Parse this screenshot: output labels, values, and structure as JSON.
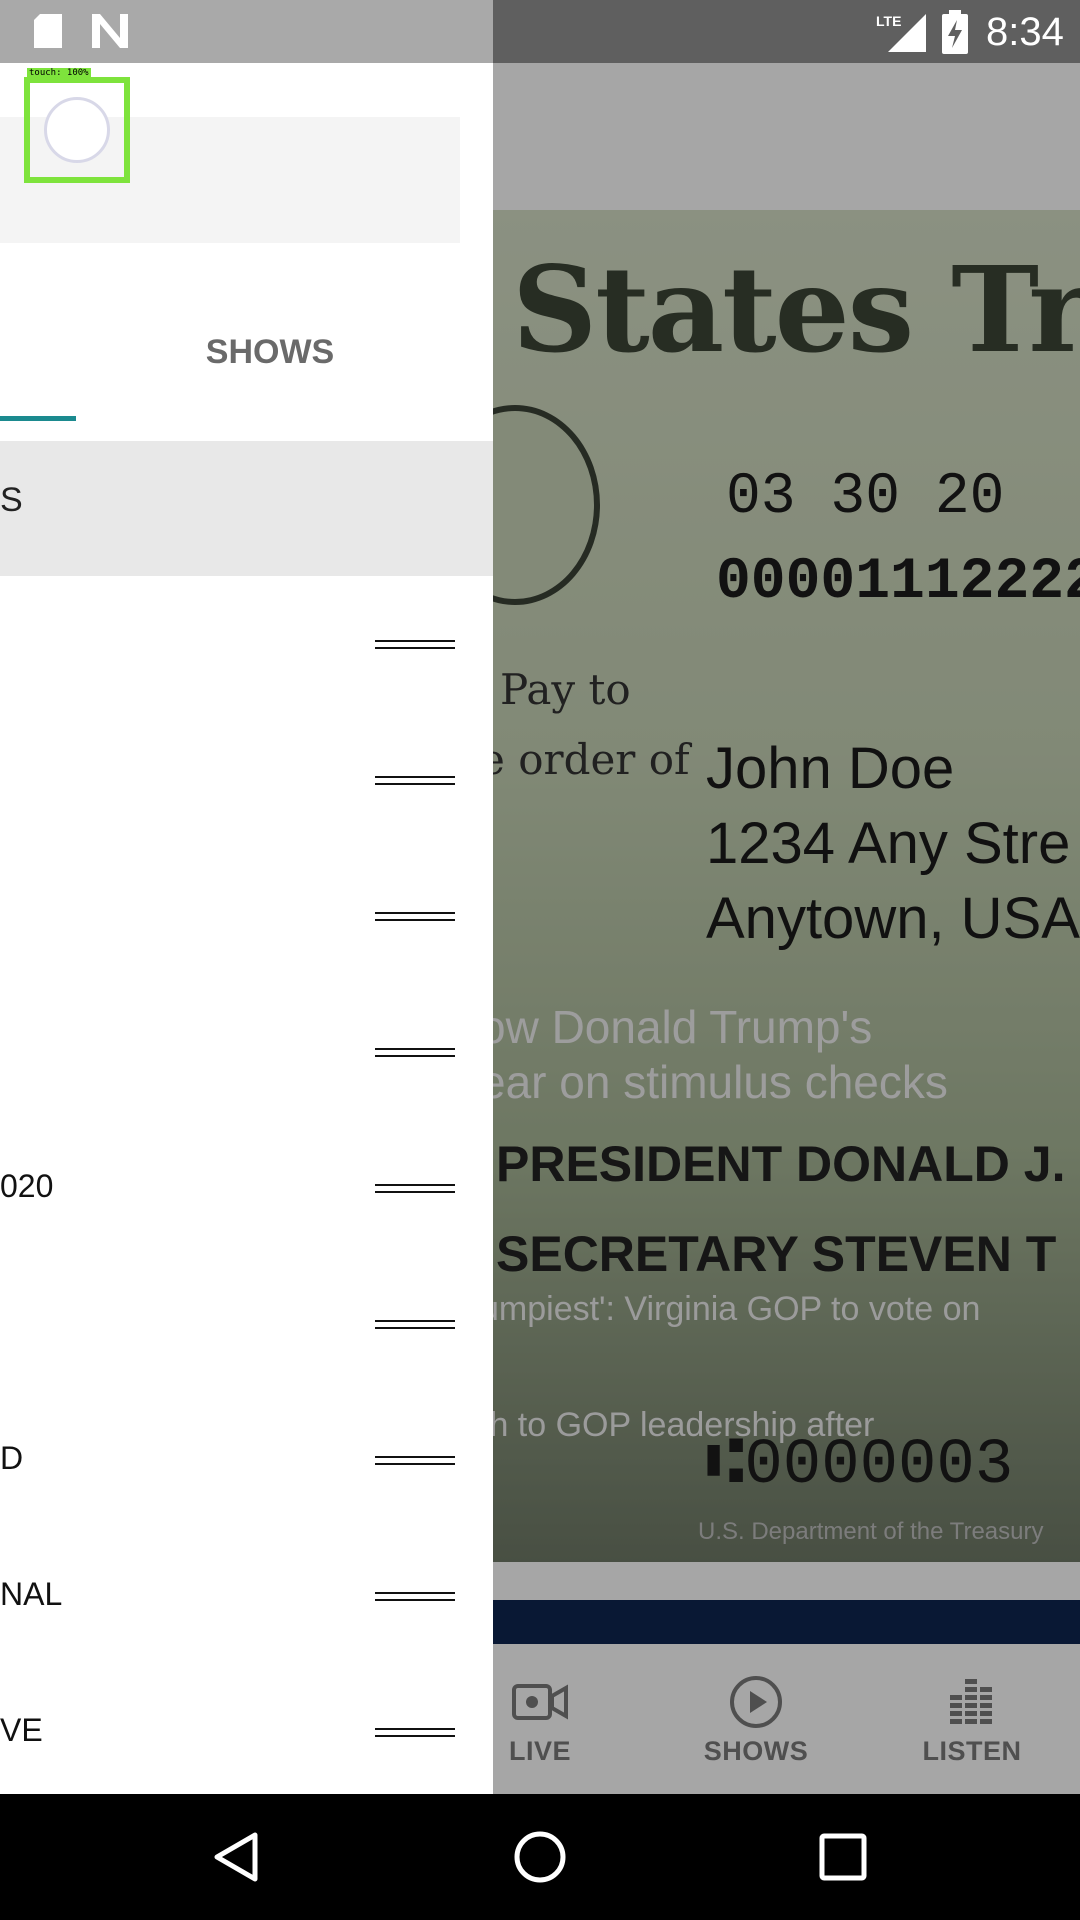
{
  "status_bar": {
    "time": "8:34",
    "network": "LTE",
    "icons": [
      "sd-card-icon",
      "n-icon",
      "lte-signal-icon",
      "battery-charging-icon"
    ]
  },
  "touch_overlay": {
    "label": "touch: 100%"
  },
  "drawer": {
    "tab_label": "SHOWS",
    "selected_item": "S",
    "items": [
      {
        "label": ""
      },
      {
        "label": ""
      },
      {
        "label": ""
      },
      {
        "label": ""
      },
      {
        "label": "020"
      },
      {
        "label": ""
      },
      {
        "label": "D"
      },
      {
        "label": "NAL"
      },
      {
        "label": "VE"
      }
    ],
    "accent_color": "#1b8a8f"
  },
  "hero": {
    "check_heading": "States Treas",
    "check_date": "03 30 20",
    "check_number": "00001112222",
    "pay_to": "Pay to",
    "order_of": "e order of",
    "payee_name": "John Doe",
    "payee_street": "1234 Any Stre",
    "payee_town": "Anytown, USA",
    "president_line": "PRESIDENT DONALD J.",
    "secretary_line": "SECRETARY STEVEN T",
    "micr": "⑆0000003",
    "caption_line1": "ow Donald Trump's",
    "caption_line2": "ear on stimulus checks",
    "story_1": "umpiest': Virginia GOP to vote on",
    "story_2": "th to GOP leadership after",
    "credit": "U.S. Department of the Treasury"
  },
  "bottom_nav": {
    "live": "LIVE",
    "shows": "SHOWS",
    "listen": "LISTEN"
  },
  "system_nav": {
    "icons": [
      "back-icon",
      "home-icon",
      "recents-icon"
    ]
  }
}
